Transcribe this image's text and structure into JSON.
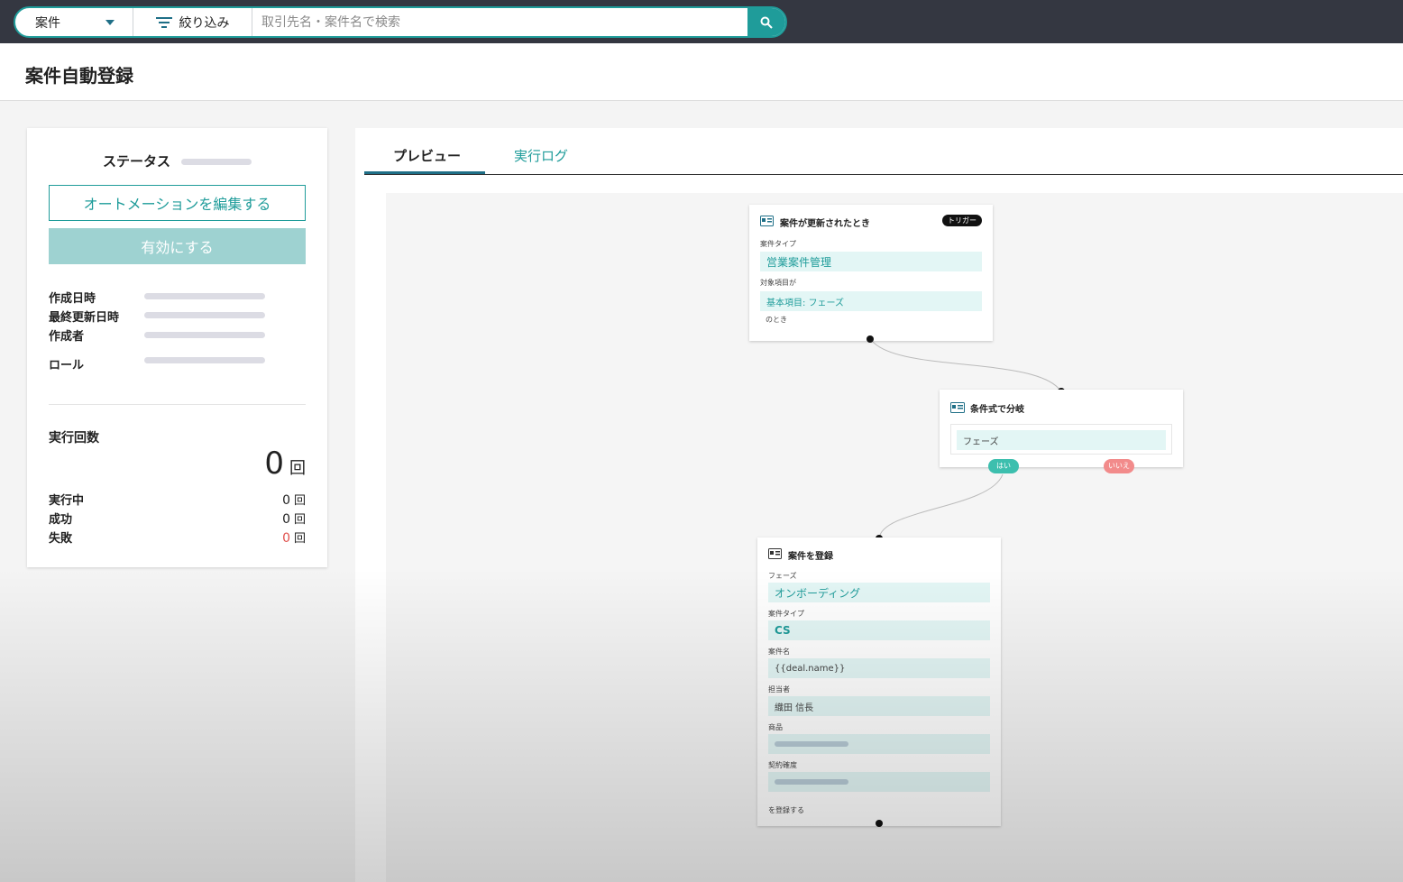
{
  "search": {
    "scope": "案件",
    "filter_label": "絞り込み",
    "placeholder": "取引先名・案件名で検索"
  },
  "page": {
    "title": "案件自動登録"
  },
  "sidebar": {
    "status_label": "ステータス",
    "edit_button": "オートメーションを編集する",
    "enable_button": "有効にする",
    "meta": {
      "created_at": "作成日時",
      "updated_at": "最終更新日時",
      "author": "作成者",
      "role": "ロール"
    },
    "runs": {
      "title": "実行回数",
      "total": "0",
      "unit": "回",
      "running_label": "実行中",
      "running": "0",
      "success_label": "成功",
      "success": "0",
      "failed_label": "失敗",
      "failed": "0"
    }
  },
  "tabs": {
    "preview": "プレビュー",
    "log": "実行ログ"
  },
  "flow": {
    "trigger": {
      "title": "案件が更新されたとき",
      "badge": "トリガー",
      "type_label": "案件タイプ",
      "type_value": "営業案件管理",
      "target_label": "対象項目が",
      "target_value": "基本項目: フェーズ",
      "suffix": "のとき"
    },
    "branch": {
      "title": "条件式で分岐",
      "condition": "フェーズ",
      "yes": "はい",
      "no": "いいえ"
    },
    "action": {
      "title": "案件を登録",
      "fields": [
        {
          "label": "フェーズ",
          "value": "オンボーディング"
        },
        {
          "label": "案件タイプ",
          "value": "CS"
        },
        {
          "label": "案件名",
          "value": "{{deal.name}}"
        },
        {
          "label": "担当者",
          "value": "織田 信長"
        },
        {
          "label": "商品",
          "value": ""
        },
        {
          "label": "契約確度",
          "value": ""
        }
      ],
      "suffix": "を登録する"
    }
  },
  "colors": {
    "accent": "#1f9c9a",
    "topbar": "#343741",
    "no_pill": "#f28b8b",
    "yes_pill": "#3dbfae",
    "failed": "#e0504c"
  },
  "icons": [
    "chevron-down-icon",
    "filter-icon",
    "search-icon",
    "record-card-icon"
  ]
}
